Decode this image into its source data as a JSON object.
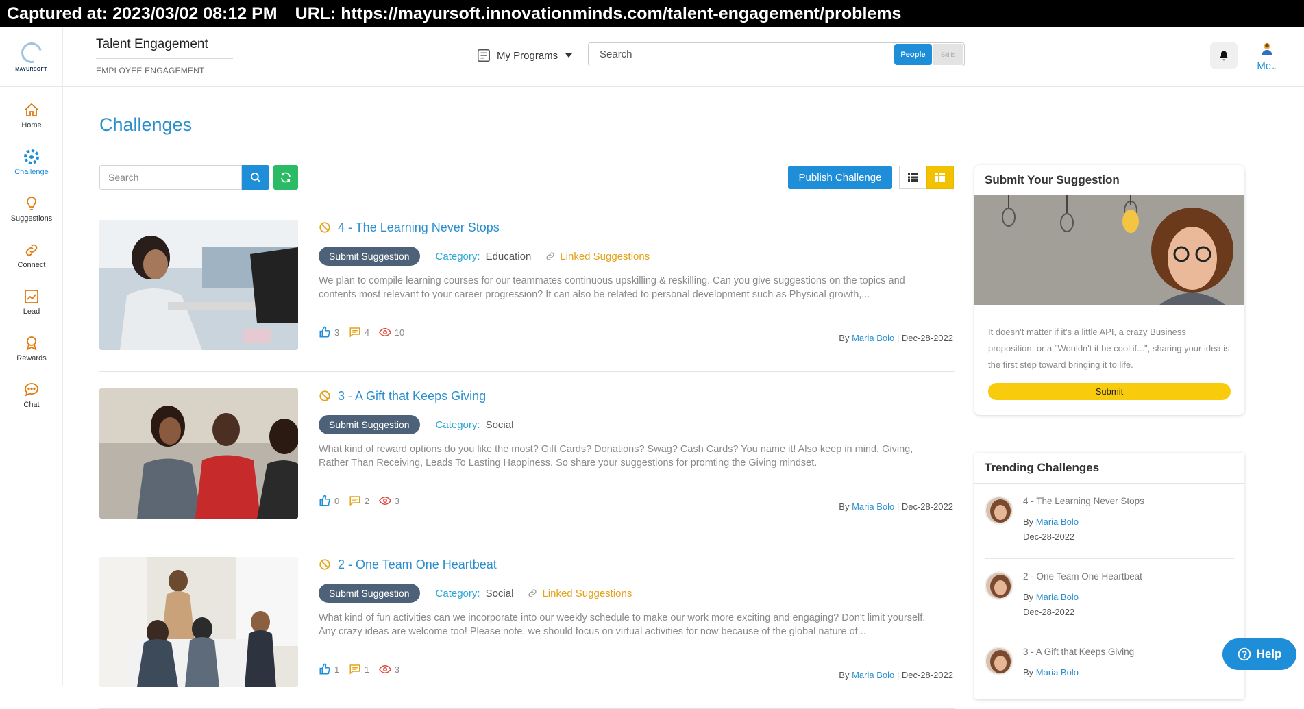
{
  "capture": {
    "timestamp": "Captured at: 2023/03/02 08:12 PM",
    "url": "URL: https://mayursoft.innovationminds.com/talent-engagement/problems"
  },
  "header": {
    "logo_text": "MAYURSOFT",
    "brand_title": "Talent Engagement",
    "brand_subtitle": "EMPLOYEE ENGAGEMENT",
    "programs_label": "My Programs",
    "search_placeholder": "Search",
    "toggle_people": "People",
    "toggle_skills": "Skills",
    "me_label": "Me"
  },
  "sidebar": {
    "items": [
      {
        "label": "Home",
        "icon": "home-icon"
      },
      {
        "label": "Challenge",
        "icon": "challenge-icon"
      },
      {
        "label": "Suggestions",
        "icon": "bulb-icon"
      },
      {
        "label": "Connect",
        "icon": "link-icon"
      },
      {
        "label": "Lead",
        "icon": "chart-icon"
      },
      {
        "label": "Rewards",
        "icon": "medal-icon"
      },
      {
        "label": "Chat",
        "icon": "chat-icon"
      }
    ]
  },
  "main": {
    "title": "Challenges",
    "search_placeholder": "Search",
    "publish_label": "Publish Challenge",
    "submit_suggestion_label": "Submit Suggestion",
    "category_label": "Category:",
    "linked_label": "Linked Suggestions",
    "by_label": "By",
    "challenges": [
      {
        "title": "4 - The Learning Never Stops",
        "category": "Education",
        "linked": true,
        "description": "We plan to compile learning courses for our teammates continuous upskilling & reskilling. Can you give suggestions on the topics and contents most relevant to your career progression? It can also be related to personal development such as Physical growth,...",
        "likes": "3",
        "comments": "4",
        "views": "10",
        "author": "Maria Bolo",
        "date": "| Dec-28-2022"
      },
      {
        "title": "3 - A Gift that Keeps Giving",
        "category": "Social",
        "linked": false,
        "description": "What kind of reward options do you like the most? Gift Cards? Donations? Swag? Cash Cards? You name it! Also keep in mind, Giving, Rather Than Receiving, Leads To Lasting Happiness. So share your suggestions for promting the Giving mindset.",
        "likes": "0",
        "comments": "2",
        "views": "3",
        "author": "Maria Bolo",
        "date": "| Dec-28-2022"
      },
      {
        "title": "2 - One Team One Heartbeat",
        "category": "Social",
        "linked": true,
        "description": "What kind of fun activities can we incorporate into our weekly schedule to make our work more exciting and engaging? Don't limit yourself. Any crazy ideas are welcome too! Please note, we should focus on virtual activities for now because of the global nature of...",
        "likes": "1",
        "comments": "1",
        "views": "3",
        "author": "Maria Bolo",
        "date": "| Dec-28-2022"
      }
    ]
  },
  "suggestion_panel": {
    "title": "Submit Your Suggestion",
    "text": "It doesn't matter if it's a little API, a crazy Business proposition, or a \"Wouldn't it be cool if...\", sharing your idea is the first step toward bringing it to life.",
    "button": "Submit"
  },
  "trending": {
    "title": "Trending Challenges",
    "by_label": "By",
    "items": [
      {
        "title": "4 - The Learning Never Stops",
        "author": "Maria Bolo",
        "date": "Dec-28-2022"
      },
      {
        "title": "2 - One Team One Heartbeat",
        "author": "Maria Bolo",
        "date": "Dec-28-2022"
      },
      {
        "title": "3 - A Gift that Keeps Giving",
        "author": "Maria Bolo",
        "date": ""
      }
    ]
  },
  "help_label": "Help",
  "colors": {
    "accent": "#1e8ed8",
    "title_blue": "#2b8fce",
    "refresh_green": "#2bbb64",
    "grid_toggle_yellow": "#f2c200",
    "submit_yellow": "#f8cc0c",
    "linked_orange": "#e3a21a",
    "pill_slate": "#4d6178"
  }
}
